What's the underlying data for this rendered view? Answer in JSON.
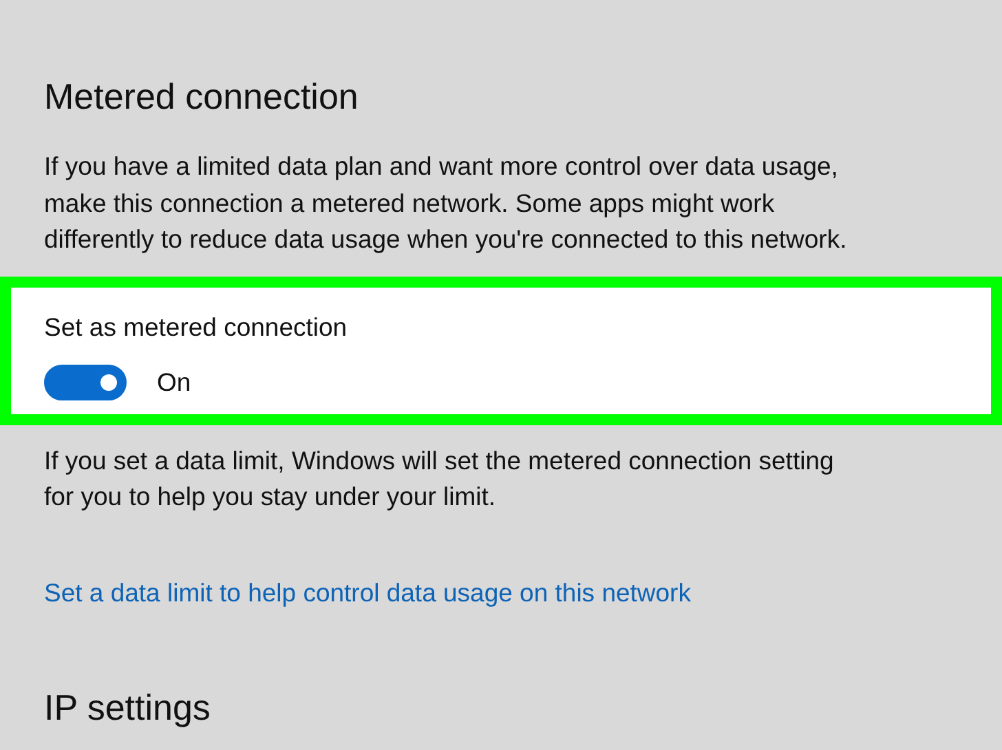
{
  "section_title": "Metered connection",
  "description": "If you have a limited data plan and want more control over data usage, make this connection a metered network. Some apps might work differently to reduce data usage when you're connected to this network.",
  "metered_setting": {
    "label": "Set as metered connection",
    "on": true,
    "state_text": "On",
    "highlighted": true
  },
  "limit_note": "If you set a data limit, Windows will set the metered connection setting for you to help you stay under your limit.",
  "link": "Set a data limit to help control data usage on this network",
  "next_section_title": "IP settings"
}
